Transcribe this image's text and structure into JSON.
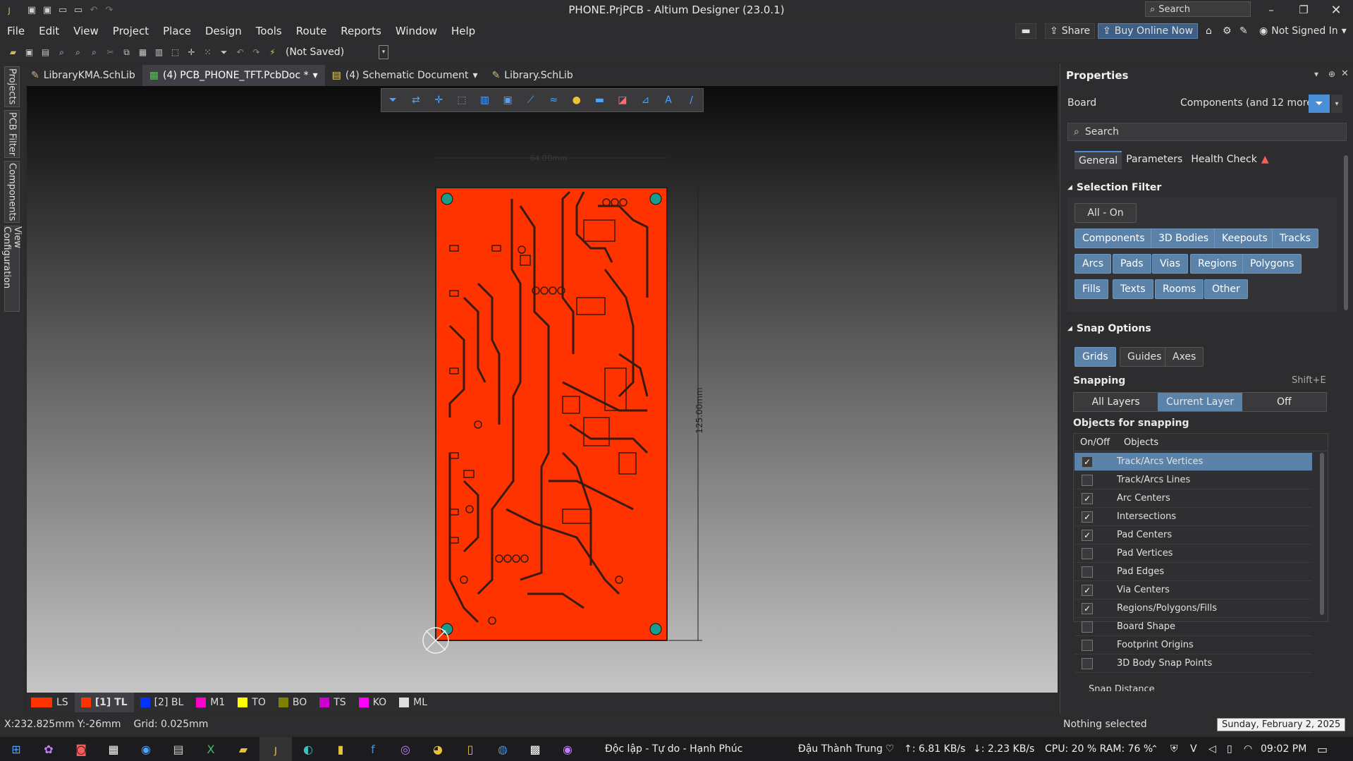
{
  "window": {
    "title": "PHONE.PrjPCB - Altium Designer (23.0.1)",
    "search_placeholder": "Search"
  },
  "menu": [
    "File",
    "Edit",
    "View",
    "Project",
    "Place",
    "Design",
    "Tools",
    "Route",
    "Reports",
    "Window",
    "Help"
  ],
  "menu_right": {
    "share": "Share",
    "buy": "Buy Online Now",
    "user": "Not Signed In"
  },
  "toolbar": {
    "save_status": "(Not Saved)"
  },
  "left_tabs": [
    "Projects",
    "PCB Filter",
    "Components",
    "View Configuration"
  ],
  "doc_tabs": [
    {
      "label": "LibraryKMA.SchLib",
      "active": false
    },
    {
      "label": "(4) PCB_PHONE_TFT.PcbDoc *",
      "active": true
    },
    {
      "label": "(4) Schematic Document",
      "active": false
    },
    {
      "label": "Library.SchLib",
      "active": false
    }
  ],
  "board": {
    "width_label": "64.00mm",
    "height_label": "125.00mm"
  },
  "layers": [
    {
      "label": "LS",
      "color": "#ff3300"
    },
    {
      "label": "[1] TL",
      "color": "#ff3300"
    },
    {
      "label": "[2] BL",
      "color": "#0033ff"
    },
    {
      "label": "M1",
      "color": "#ff00cc"
    },
    {
      "label": "TO",
      "color": "#ffff00"
    },
    {
      "label": "BO",
      "color": "#808000"
    },
    {
      "label": "TS",
      "color": "#cc00cc"
    },
    {
      "label": "KO",
      "color": "#ff00ff"
    },
    {
      "label": "ML",
      "color": "#dddddd"
    }
  ],
  "status": {
    "coords": "X:232.825mm Y:-26mm",
    "grid": "Grid: 0.025mm",
    "selection": "Nothing selected",
    "date_tooltip": "Sunday, February 2, 2025"
  },
  "properties": {
    "title": "Properties",
    "board_label": "Board",
    "filter_label": "Components (and 12 more)",
    "search_placeholder": "Search",
    "tabs": [
      "General",
      "Parameters",
      "Health Check"
    ],
    "selection_filter": {
      "title": "Selection Filter",
      "all_on": "All - On",
      "items": [
        "Components",
        "3D Bodies",
        "Keepouts",
        "Tracks",
        "Arcs",
        "Pads",
        "Vias",
        "Regions",
        "Polygons",
        "Fills",
        "Texts",
        "Rooms",
        "Other"
      ]
    },
    "snap_options": {
      "title": "Snap Options",
      "items": [
        "Grids",
        "Guides",
        "Axes"
      ],
      "snapping_label": "Snapping",
      "snapping_shortcut": "Shift+E",
      "snapping_modes": [
        "All Layers",
        "Current Layer",
        "Off"
      ],
      "objects_label": "Objects for snapping",
      "col_onoff": "On/Off",
      "col_objects": "Objects",
      "objects": [
        {
          "name": "Track/Arcs Vertices",
          "on": true
        },
        {
          "name": "Track/Arcs Lines",
          "on": false
        },
        {
          "name": "Arc Centers",
          "on": true
        },
        {
          "name": "Intersections",
          "on": true
        },
        {
          "name": "Pad Centers",
          "on": true
        },
        {
          "name": "Pad Vertices",
          "on": false
        },
        {
          "name": "Pad Edges",
          "on": false
        },
        {
          "name": "Via Centers",
          "on": true
        },
        {
          "name": "Regions/Polygons/Fills",
          "on": true
        },
        {
          "name": "Board Shape",
          "on": false
        },
        {
          "name": "Footprint Origins",
          "on": false
        },
        {
          "name": "3D Body Snap Points",
          "on": false
        }
      ],
      "snap_distance_label": "Snap Distance"
    }
  },
  "taskbar": {
    "motto": "Độc lập - Tự do - Hạnh Phúc",
    "user": "Đậu Thành Trung",
    "upload": "↑: 6.81 KB/s",
    "download": "↓: 2.23 KB/s",
    "cpu_ram": "CPU: 20 % RAM: 76 %",
    "time": "09:02 PM"
  }
}
